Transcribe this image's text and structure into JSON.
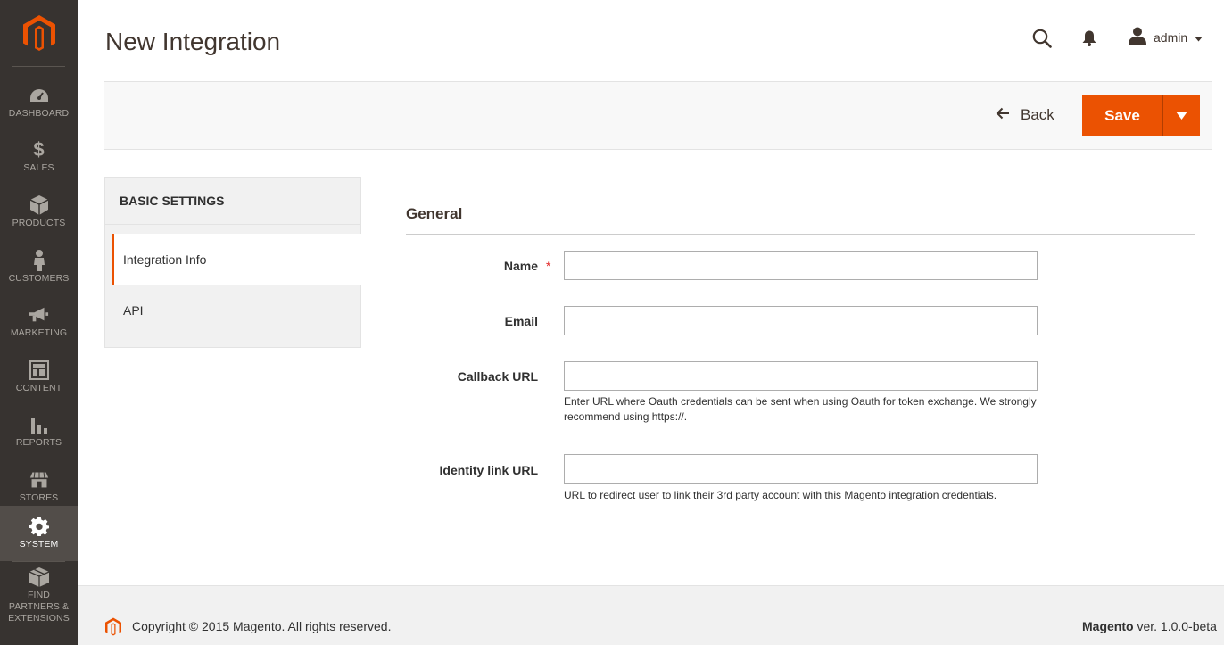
{
  "sidebar": {
    "logo_icon": "magento-logo-icon",
    "items": [
      {
        "label": "DASHBOARD",
        "icon": "speedometer-icon"
      },
      {
        "label": "SALES",
        "icon": "dollar-icon"
      },
      {
        "label": "PRODUCTS",
        "icon": "cube-icon"
      },
      {
        "label": "CUSTOMERS",
        "icon": "person-icon"
      },
      {
        "label": "MARKETING",
        "icon": "megaphone-icon"
      },
      {
        "label": "CONTENT",
        "icon": "layout-icon"
      },
      {
        "label": "REPORTS",
        "icon": "bar-chart-icon"
      },
      {
        "label": "STORES",
        "icon": "storefront-icon"
      },
      {
        "label": "SYSTEM",
        "icon": "gear-icon",
        "active": true
      },
      {
        "label": "FIND PARTNERS & EXTENSIONS",
        "icon": "package-icon"
      }
    ]
  },
  "header": {
    "title": "New Integration",
    "user": "admin"
  },
  "actions": {
    "back_label": "Back",
    "save_label": "Save"
  },
  "tabs": {
    "title": "BASIC SETTINGS",
    "items": [
      {
        "label": "Integration Info",
        "active": true
      },
      {
        "label": "API",
        "active": false
      }
    ]
  },
  "form": {
    "section_title": "General",
    "fields": [
      {
        "label": "Name",
        "required": true,
        "value": "",
        "note": ""
      },
      {
        "label": "Email",
        "required": false,
        "value": "",
        "note": ""
      },
      {
        "label": "Callback URL",
        "required": false,
        "value": "",
        "note": "Enter URL where Oauth credentials can be sent when using Oauth for token exchange. We strongly recommend using https://."
      },
      {
        "label": "Identity link URL",
        "required": false,
        "value": "",
        "note": "URL to redirect user to link their 3rd party account with this Magento integration credentials."
      }
    ],
    "required_mark": "*"
  },
  "footer": {
    "copyright": "Copyright © 2015 Magento. All rights reserved.",
    "brand": "Magento",
    "version": " ver. 1.0.0-beta"
  },
  "colors": {
    "accent": "#eb5202",
    "sidebar_bg": "#373330",
    "sidebar_active": "#524d49"
  }
}
